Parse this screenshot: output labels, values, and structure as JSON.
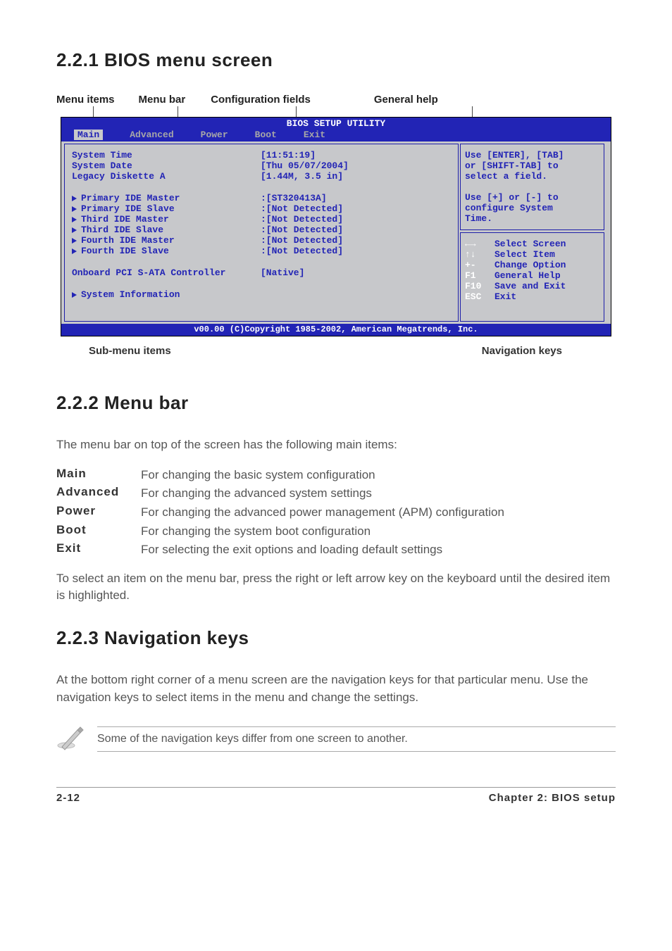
{
  "section221": {
    "heading": "2.2.1   BIOS menu screen",
    "labels": {
      "menu_items": "Menu items",
      "menu_bar": "Menu bar",
      "config_fields": "Configuration fields",
      "general_help": "General help",
      "submenu_items": "Sub-menu items",
      "nav_keys": "Navigation keys"
    }
  },
  "bios": {
    "title": "BIOS SETUP UTILITY",
    "menubar": [
      "Main",
      "Advanced",
      "Power",
      "Boot",
      "Exit"
    ],
    "left_rows": [
      {
        "label": "System Time",
        "value": "[11:51:19]",
        "tri": false
      },
      {
        "label": "System Date",
        "value": "[Thu 05/07/2004]",
        "tri": false
      },
      {
        "label": "Legacy Diskette A",
        "value": "[1.44M, 3.5 in]",
        "tri": false
      },
      {
        "spacer": true
      },
      {
        "label": "Primary IDE Master",
        "value": ":[ST320413A]",
        "tri": true
      },
      {
        "label": "Primary IDE Slave",
        "value": ":[Not Detected]",
        "tri": true
      },
      {
        "label": "Third IDE Master",
        "value": ":[Not Detected]",
        "tri": true
      },
      {
        "label": "Third IDE Slave",
        "value": ":[Not Detected]",
        "tri": true
      },
      {
        "label": "Fourth IDE Master",
        "value": ":[Not Detected]",
        "tri": true
      },
      {
        "label": "Fourth IDE Slave",
        "value": ":[Not Detected]",
        "tri": true
      },
      {
        "spacer": true
      },
      {
        "label": "Onboard PCI S-ATA Controller",
        "value": " [Native]",
        "tri": false
      },
      {
        "spacer": true
      },
      {
        "label": "System Information",
        "value": "",
        "tri": true
      }
    ],
    "help_top": [
      "Use [ENTER], [TAB]",
      "or [SHIFT-TAB] to",
      "select a field.",
      "",
      "Use [+] or [-] to",
      "configure System",
      "Time."
    ],
    "nav": [
      {
        "key": "←→",
        "desc": "Select Screen"
      },
      {
        "key": "↑↓",
        "desc": "Select Item"
      },
      {
        "key": "+-",
        "desc": "Change Option"
      },
      {
        "key": "F1",
        "desc": "General Help"
      },
      {
        "key": "F10",
        "desc": "Save and Exit"
      },
      {
        "key": "ESC",
        "desc": "Exit"
      }
    ],
    "footer": "v00.00 (C)Copyright 1985-2002, American Megatrends, Inc."
  },
  "section222": {
    "heading": "2.2.2   Menu bar",
    "intro": "The menu bar on top of the screen has the following main items:",
    "defs": [
      {
        "term": "Main",
        "desc": "For changing the basic system configuration"
      },
      {
        "term": "Advanced",
        "desc": "For changing the advanced system settings"
      },
      {
        "term": "Power",
        "desc": "For changing the advanced power management (APM) configuration"
      },
      {
        "term": "Boot",
        "desc": "For changing the system boot configuration"
      },
      {
        "term": "Exit",
        "desc": "For selecting the exit options and loading default settings"
      }
    ],
    "para": "To select an item on the menu bar, press the right or left arrow key on the keyboard until the desired item is highlighted."
  },
  "section223": {
    "heading": "2.2.3   Navigation keys",
    "para": "At the bottom right corner of a menu screen are the navigation keys for that particular menu. Use the navigation keys to select items in the menu and change the settings.",
    "note": "Some of the navigation keys differ from one screen to another."
  },
  "footer": {
    "left": "2-12",
    "right": "Chapter 2: BIOS setup"
  }
}
